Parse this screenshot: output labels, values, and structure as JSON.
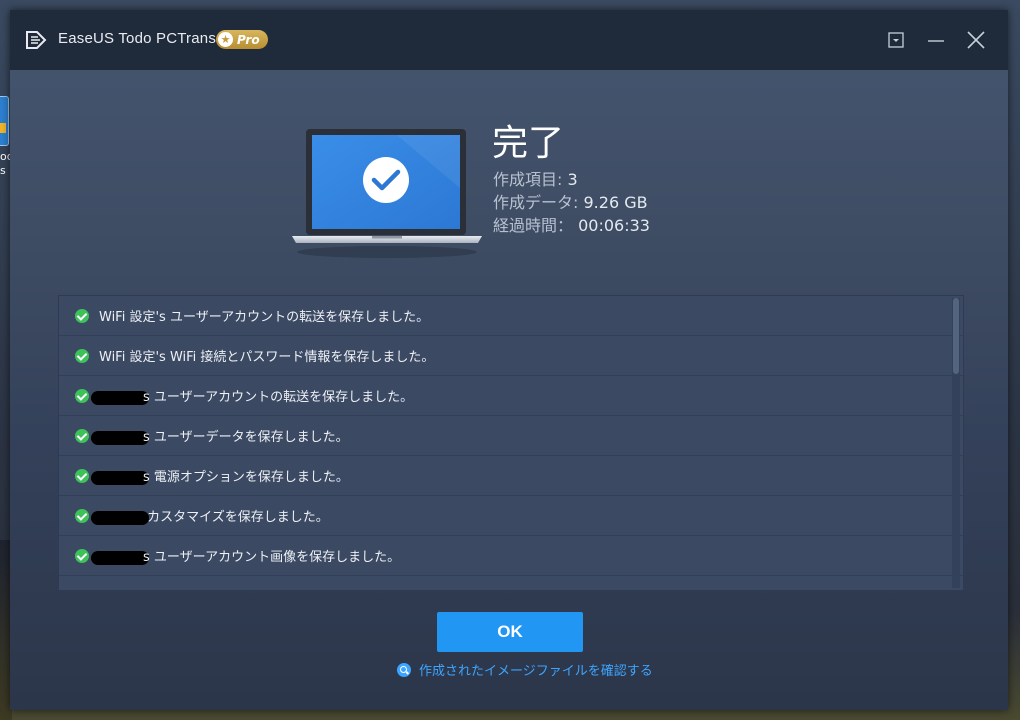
{
  "window": {
    "app_title": "EaseUS Todo PCTrans",
    "badge": "Pro",
    "controls": [
      "menu-icon",
      "minimize-icon",
      "close-icon"
    ]
  },
  "desktop": {
    "icon_label": "od\ns"
  },
  "summary": {
    "title": "完了",
    "items_label": "作成項目:",
    "items_value": "3",
    "data_label": "作成データ:",
    "data_value": "9.26 GB",
    "time_label": "経過時間：",
    "time_value": "00:06:33"
  },
  "log": {
    "items": [
      {
        "prefix": "WiFi 設定's",
        "redacted": false,
        "text": "ユーザーアカウントの転送を保存しました。"
      },
      {
        "prefix": "WiFi 設定's",
        "redacted": false,
        "text": "WiFi 接続とパスワード情報を保存しました。"
      },
      {
        "prefix": "s",
        "redacted": true,
        "text": "ユーザーアカウントの転送を保存しました。"
      },
      {
        "prefix": "s",
        "redacted": true,
        "text": "ユーザーデータを保存しました。"
      },
      {
        "prefix": "s",
        "redacted": true,
        "text": "電源オプションを保存しました。"
      },
      {
        "prefix": "",
        "redacted": true,
        "text": "カスタマイズを保存しました。"
      },
      {
        "prefix": "s",
        "redacted": true,
        "text": "ユーザーアカウント画像を保存しました。"
      },
      {
        "prefix": "",
        "redacted": false,
        "text": ""
      }
    ]
  },
  "actions": {
    "ok_label": "OK",
    "view_images_label": "作成されたイメージファイルを確認する"
  },
  "colors": {
    "accent": "#2196f3",
    "link": "#3da5ff",
    "success": "#3dc25a",
    "titlebar": "#1f2a3a",
    "badge_gold": "#c49a3a"
  }
}
